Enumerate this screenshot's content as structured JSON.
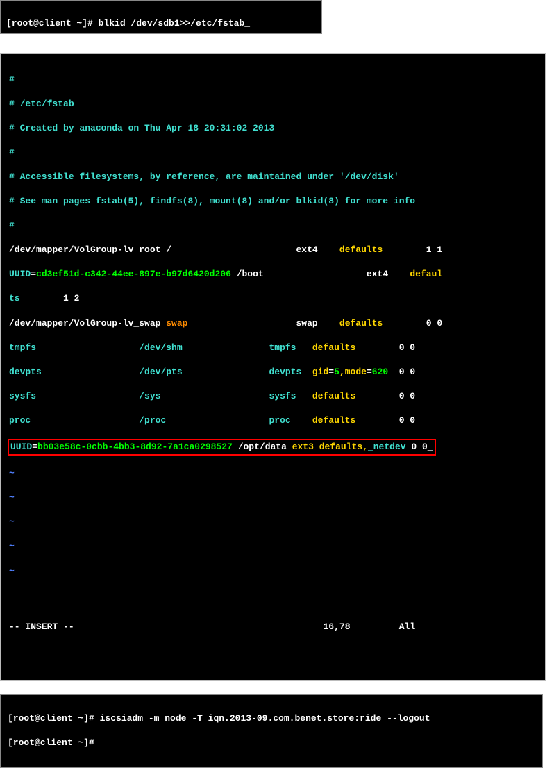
{
  "term1": {
    "line1": "[root@client ~]# blkid /dev/sdb1>>/etc/fstab_"
  },
  "term2": {
    "c1": "#",
    "c2": "# /etc/fstab",
    "c3": "# Created by anaconda on Thu Apr 18 20:31:02 2013",
    "c4": "#",
    "c5": "# Accessible filesystems, by reference, are maintained under '/dev/disk'",
    "c6": "# See man pages fstab(5), findfs(8), mount(8) and/or blkid(8) for more info",
    "c7": "#",
    "l8a": "/dev/mapper/VolGroup-lv_root /                       ext4    ",
    "l8b": "defaults",
    "l8c": "        1 1",
    "l9a": "UUID",
    "l9b": "=",
    "l9c": "cd3ef51d-c342-44ee-897e-b97d6420d206",
    "l9d": " /boot                   ext4    ",
    "l9e": "defaul",
    "l10a": "ts",
    "l10b": "        1 2",
    "l11a": "/dev/mapper/VolGroup-lv_swap ",
    "l11b": "swap",
    "l11c": "                    swap    ",
    "l11d": "defaults",
    "l11e": "        0 0",
    "l12a": "tmpfs                   /dev/shm                tmpfs   ",
    "l12b": "defaults",
    "l12c": "        0 0",
    "l13a": "devpts                  /dev/pts                devpts  ",
    "l13b": "gid",
    "l13c": "=",
    "l13d": "5",
    "l13e": ",",
    "l13f": "mode",
    "l13g": "=",
    "l13h": "620",
    "l13i": "  0 0",
    "l14a": "sysfs                   /sys                    sysfs   ",
    "l14b": "defaults",
    "l14c": "        0 0",
    "l15a": "proc                    /proc                   proc    ",
    "l15b": "defaults",
    "l15c": "        0 0",
    "l16a": "UUID",
    "l16b": "=",
    "l16c": "bb03e58c-0cbb-4bb3-8d92-7a1ca0298527",
    "l16d": " /opt/data ",
    "l16e": "ext3 defaults",
    "l16f": ",",
    "l16g": "_netdev",
    "l16h": " 0 0",
    "l16i": "_",
    "tilde": "~",
    "status_left": "-- INSERT --",
    "status_mid": "16,78",
    "status_right": "All"
  },
  "term3": {
    "line1": "[root@client ~]# iscsiadm -m node -T iqn.2013-09.com.benet.store:ride --logout",
    "line2": "[root@client ~]# _"
  }
}
